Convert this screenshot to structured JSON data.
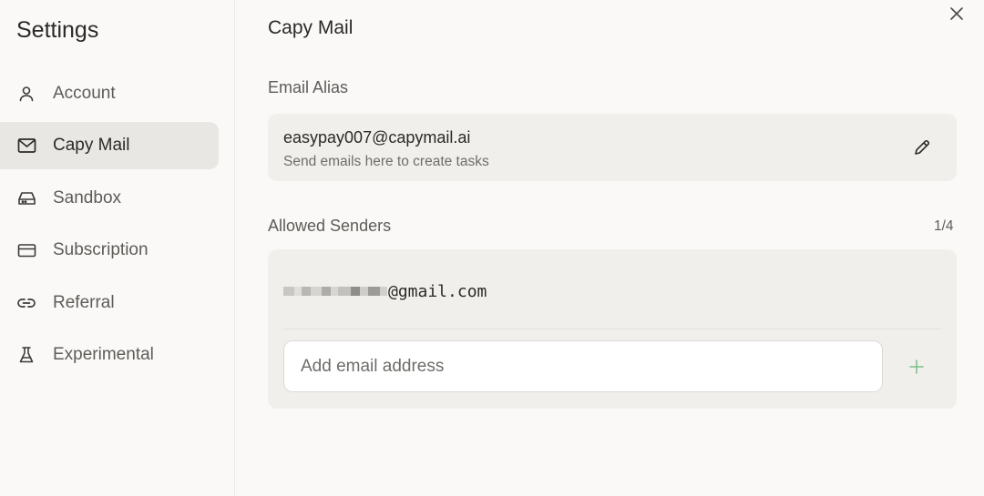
{
  "sidebar": {
    "title": "Settings",
    "items": [
      {
        "label": "Account",
        "icon": "user-icon"
      },
      {
        "label": "Capy Mail",
        "icon": "mail-icon",
        "active": true
      },
      {
        "label": "Sandbox",
        "icon": "hard-drive-icon"
      },
      {
        "label": "Subscription",
        "icon": "credit-card-icon"
      },
      {
        "label": "Referral",
        "icon": "link-icon"
      },
      {
        "label": "Experimental",
        "icon": "flask-icon"
      }
    ]
  },
  "main": {
    "title": "Capy Mail",
    "alias": {
      "label": "Email Alias",
      "email": "easypay007@capymail.ai",
      "description": "Send emails here to create tasks"
    },
    "senders": {
      "label": "Allowed Senders",
      "count": "1/4",
      "items": [
        {
          "email_visible": "@gmail.com"
        }
      ],
      "input_placeholder": "Add email address",
      "input_value": ""
    }
  },
  "colors": {
    "background": "#faf9f7",
    "active_nav": "#e9e7e3",
    "card": "#f1efec",
    "add_accent": "#7cc08a"
  }
}
